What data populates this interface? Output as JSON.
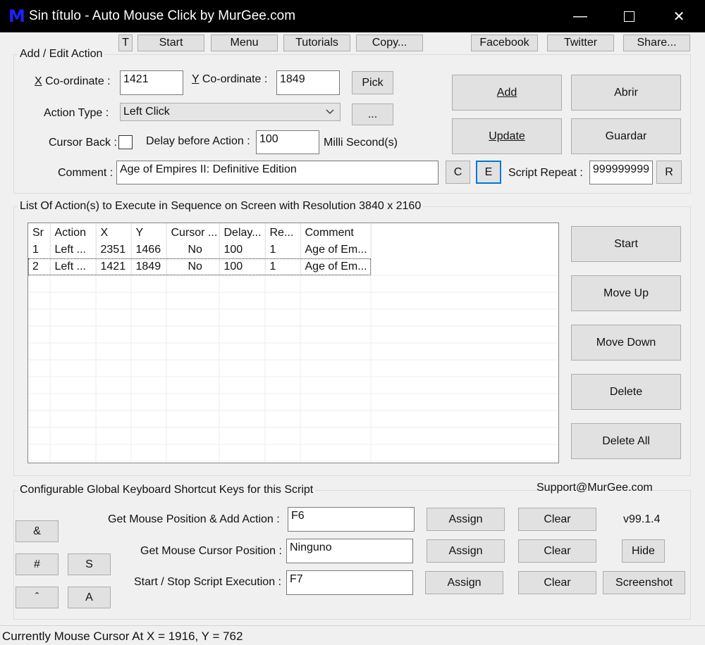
{
  "window": {
    "logo": "M",
    "title": "Sin título - Auto Mouse Click by MurGee.com",
    "minimize_glyph": "—",
    "maximize_glyph": "☐",
    "close_glyph": "✕"
  },
  "toolbar": {
    "t_label": "T",
    "start_label": "Start",
    "menu_label": "Menu",
    "tutorials_label": "Tutorials",
    "copy_label": "Copy...",
    "facebook_label": "Facebook",
    "twitter_label": "Twitter",
    "share_label": "Share..."
  },
  "edit": {
    "group_title": "Add / Edit Action",
    "x_label_key": "X",
    "x_label_rest": " Co-ordinate :",
    "x_value": "1421",
    "y_label_key": "Y",
    "y_label_rest": " Co-ordinate :",
    "y_value": "1849",
    "pick_label": "Pick",
    "action_type_label": "Action Type :",
    "action_type_value": "Left Click",
    "more_label": "...",
    "cursor_back_label": "Cursor Back :",
    "delay_label": "Delay before Action :",
    "delay_value": "100",
    "delay_unit": "Milli Second(s)",
    "comment_label": "Comment :",
    "comment_value": "Age of Empires II: Definitive Edition",
    "c_label": "C",
    "e_label": "E",
    "script_repeat_label": "Script Repeat :",
    "script_repeat_value": "999999999",
    "r_label": "R",
    "add_label": "Add",
    "open_label": "Abrir",
    "update_label": "Update",
    "save_label": "Guardar"
  },
  "list": {
    "group_title": "List Of Action(s) to Execute in Sequence on Screen with Resolution 3840 x 2160",
    "columns": [
      "Sr",
      "Action",
      "X",
      "Y",
      "Cursor ...",
      "Delay...",
      "Re...",
      "Comment"
    ],
    "rows": [
      [
        "1",
        "Left ...",
        "2351",
        "1466",
        "No",
        "100",
        "1",
        "Age of Em..."
      ],
      [
        "2",
        "Left ...",
        "1421",
        "1849",
        "No",
        "100",
        "1",
        "Age of Em..."
      ]
    ],
    "start_label": "Start",
    "move_up_label": "Move Up",
    "move_down_label": "Move Down",
    "delete_label": "Delete",
    "delete_all_label": "Delete All"
  },
  "shortcuts": {
    "group_title": "Configurable Global Keyboard Shortcut Keys for this Script",
    "support": "Support@MurGee.com",
    "version": "v99.1.4",
    "row1_label": "Get Mouse Position & Add Action :",
    "row1_value": "F6",
    "row2_label": "Get Mouse Cursor Position :",
    "row2_value": "Ninguno",
    "row3_label": "Start / Stop Script Execution :",
    "row3_value": "F7",
    "assign_label": "Assign",
    "clear_label": "Clear",
    "hide_label": "Hide",
    "screenshot_label": "Screenshot",
    "amp_label": "&",
    "hash_label": "#",
    "s_label": "S",
    "caret_label": "ˆ",
    "a_label": "A"
  },
  "status": {
    "text": "Currently Mouse Cursor At X = 1916, Y = 762"
  }
}
